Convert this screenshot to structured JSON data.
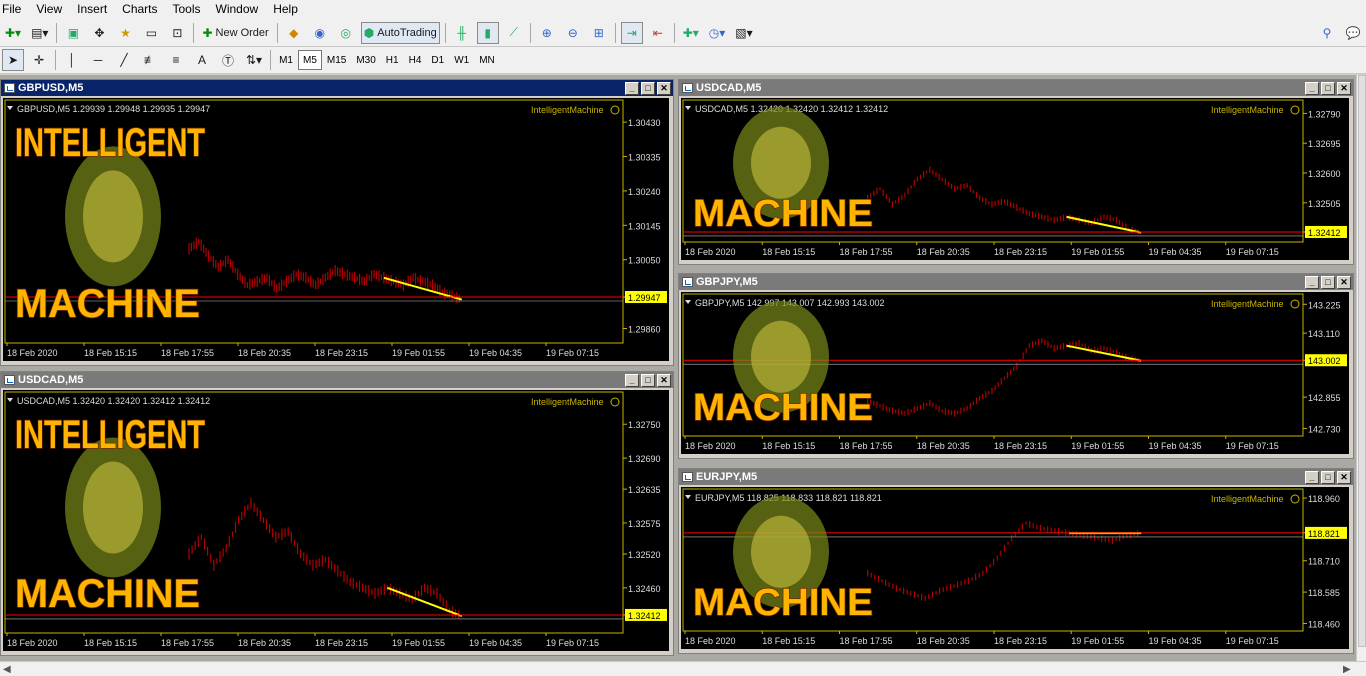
{
  "menu": [
    "File",
    "View",
    "Insert",
    "Charts",
    "Tools",
    "Window",
    "Help"
  ],
  "toolbar": {
    "new_order_label": "New Order",
    "autotrading_label": "AutoTrading"
  },
  "timeframes": [
    "M1",
    "M5",
    "M15",
    "M30",
    "H1",
    "H4",
    "D1",
    "W1",
    "MN"
  ],
  "active_timeframe": "M5",
  "indicator_label": "IntelligentMachine",
  "logo_text": [
    "INTELLIGENT",
    "MACHINE"
  ],
  "colors": {
    "bg": "#000000",
    "axis": "#c8b400",
    "candle": "#b40000",
    "bid": "#ff0000",
    "trend": "#ffff00",
    "price_tag": "#ffff00"
  },
  "time_labels": [
    "18 Feb 2020",
    "18 Feb 15:15",
    "18 Feb 17:55",
    "18 Feb 20:35",
    "18 Feb 23:15",
    "19 Feb 01:55",
    "19 Feb 04:35",
    "19 Feb 07:15"
  ],
  "windows": [
    {
      "title": "GBPUSD,M5",
      "info": "GBPUSD,M5  1.29939 1.29948 1.29935 1.29947",
      "price_levels": [
        "1.30430",
        "1.30335",
        "1.30240",
        "1.30145",
        "1.30050",
        "1.29947",
        "1.29860"
      ],
      "current_price": "1.29947",
      "series": [
        1.3008,
        1.301,
        1.3006,
        1.3003,
        1.3005,
        1.3001,
        1.2998,
        1.2999,
        1.3,
        1.2997,
        1.2999,
        1.3001,
        1.3,
        1.2998,
        1.3,
        1.3002,
        1.3001,
        1.3,
        1.2999,
        1.3001,
        1.3,
        1.2999,
        1.2998,
        1.3,
        1.2999,
        1.2998,
        1.2996,
        1.2995,
        1.2994
      ],
      "ymin": 1.2982,
      "ymax": 1.3048
    },
    {
      "title": "USDCAD,M5",
      "info": "USDCAD,M5  1.32420 1.32420 1.32412 1.32412",
      "price_levels": [
        "1.32750",
        "1.32690",
        "1.32635",
        "1.32575",
        "1.32520",
        "1.32460",
        "1.32412"
      ],
      "current_price": "1.32412",
      "series": [
        1.3252,
        1.3255,
        1.325,
        1.3253,
        1.3258,
        1.3261,
        1.3258,
        1.3255,
        1.3256,
        1.3252,
        1.325,
        1.3251,
        1.3249,
        1.3247,
        1.3246,
        1.3245,
        1.3246,
        1.3245,
        1.3244,
        1.3246,
        1.3245,
        1.3242,
        1.3241
      ],
      "ymin": 1.3238,
      "ymax": 1.328
    },
    {
      "title": "USDCAD,M5",
      "info": "USDCAD,M5  1.32420 1.32420 1.32412 1.32412",
      "price_levels": [
        "1.32790",
        "1.32695",
        "1.32600",
        "1.32505",
        "1.32412"
      ],
      "current_price": "1.32412",
      "series": [
        1.3252,
        1.3255,
        1.325,
        1.3253,
        1.3258,
        1.3261,
        1.3258,
        1.3255,
        1.3256,
        1.3252,
        1.325,
        1.3251,
        1.3249,
        1.3247,
        1.3246,
        1.3245,
        1.3246,
        1.3245,
        1.3244,
        1.3246,
        1.3245,
        1.3242,
        1.3241
      ],
      "ymin": 1.3238,
      "ymax": 1.3282
    },
    {
      "title": "GBPJPY,M5",
      "info": "GBPJPY,M5  142.997 143.007 142.993 143.002",
      "price_levels": [
        "143.225",
        "143.110",
        "143.002",
        "142.855",
        "142.730"
      ],
      "current_price": "143.002",
      "series": [
        142.84,
        142.82,
        142.8,
        142.79,
        142.81,
        142.83,
        142.8,
        142.79,
        142.81,
        142.85,
        142.88,
        142.93,
        142.98,
        143.06,
        143.08,
        143.05,
        143.06,
        143.07,
        143.04,
        143.05,
        143.03,
        143.01,
        143.0
      ],
      "ymin": 142.7,
      "ymax": 143.25
    },
    {
      "title": "EURJPY,M5",
      "info": "EURJPY,M5  118.825 118.833 118.821 118.821",
      "price_levels": [
        "118.960",
        "118.821",
        "118.710",
        "118.585",
        "118.460"
      ],
      "current_price": "118.821",
      "series": [
        118.66,
        118.63,
        118.6,
        118.58,
        118.56,
        118.59,
        118.61,
        118.63,
        118.66,
        118.72,
        118.8,
        118.86,
        118.84,
        118.83,
        118.82,
        118.81,
        118.8,
        118.79,
        118.81,
        118.82
      ],
      "ymin": 118.43,
      "ymax": 118.98
    }
  ]
}
